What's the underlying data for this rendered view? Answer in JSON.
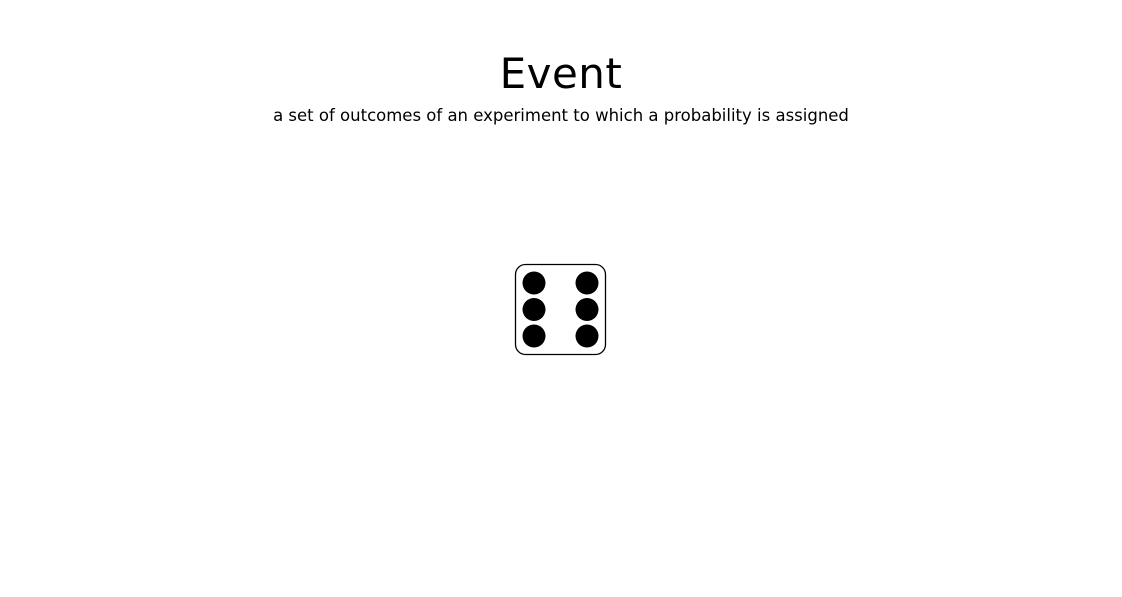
{
  "header": {
    "title": "Event",
    "subtitle": "a set of outcomes of an experiment to which a probability is assigned"
  },
  "die": {
    "icon": "die-six-icon",
    "face_value": 6,
    "pip_color": "#000000",
    "face_color": "#ffffff",
    "border_color": "#000000"
  }
}
